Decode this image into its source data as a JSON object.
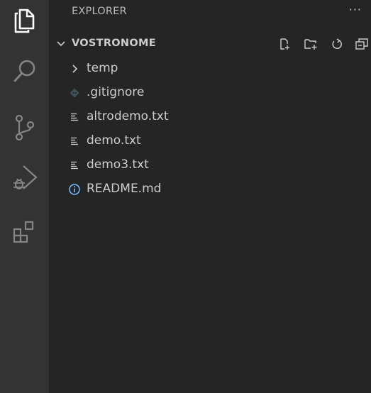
{
  "sidebar": {
    "title": "EXPLORER",
    "more_label": "···"
  },
  "section": {
    "label": "VOSTRONOME"
  },
  "activity_bar": {
    "items": [
      "files-icon",
      "search-icon",
      "source-control-icon",
      "run-debug-icon",
      "extensions-icon"
    ]
  },
  "header_actions": [
    "new-file-icon",
    "new-folder-icon",
    "refresh-icon",
    "collapse-all-icon"
  ],
  "tree": {
    "items": [
      {
        "label": "temp",
        "icon": "chevron-right-icon"
      },
      {
        "label": ".gitignore",
        "icon": "git-icon"
      },
      {
        "label": "altrodemo.txt",
        "icon": "text-file-icon"
      },
      {
        "label": "demo.txt",
        "icon": "text-file-icon"
      },
      {
        "label": "demo3.txt",
        "icon": "text-file-icon"
      },
      {
        "label": "README.md",
        "icon": "info-icon"
      }
    ]
  },
  "colors": {
    "activity_bar": "#333333",
    "sidebar": "#252526",
    "text": "#cccccc",
    "icon_active": "#ffffff",
    "icon_inactive": "#858585",
    "info_icon": "#75beff"
  }
}
